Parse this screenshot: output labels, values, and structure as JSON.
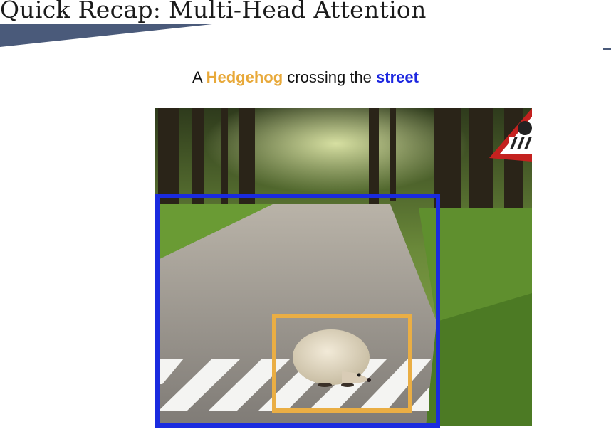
{
  "slide": {
    "title": "Quick Recap: Multi-Head Attention"
  },
  "caption": {
    "prefix": "A ",
    "word_orange": "Hedgehog",
    "middle": " crossing the ",
    "word_blue": "street"
  },
  "colors": {
    "orange_highlight": "#e8a93a",
    "blue_highlight": "#1d27e0",
    "title_band": "#4a5a7a"
  },
  "image": {
    "description_icons": [
      "hedgehog-figure",
      "crosswalk-stripes",
      "forest-trees",
      "warning-road-sign"
    ]
  }
}
